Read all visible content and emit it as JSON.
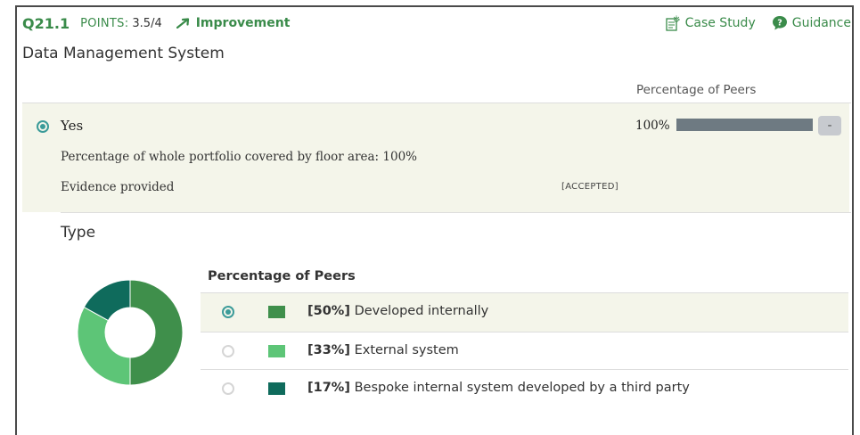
{
  "header": {
    "question_number": "Q21.1",
    "points_label": "POINTS:",
    "points_value": "3.5/4",
    "status": "Improvement",
    "case_study_label": "Case Study",
    "guidance_label": "Guidance"
  },
  "section_title": "Data Management System",
  "peers_header": "Percentage of Peers",
  "answer": {
    "label": "Yes",
    "selected": true,
    "peer_percentage_text": "100%",
    "peer_percentage": 100,
    "remove_button_label": "-",
    "coverage_text": "Percentage of whole portfolio covered by floor area: 100%",
    "evidence_text": "Evidence provided",
    "evidence_status": "[ACCEPTED]"
  },
  "type_section": {
    "title": "Type",
    "table_header": "Percentage of Peers",
    "options": [
      {
        "percent_label": "[50%]",
        "text": "Developed internally",
        "selected": true,
        "color": "#3f8f4b"
      },
      {
        "percent_label": "[33%]",
        "text": "External system",
        "selected": false,
        "color": "#5dc577"
      },
      {
        "percent_label": "[17%]",
        "text": "Bespoke internal system developed by a third party",
        "selected": false,
        "color": "#0f6b5c"
      }
    ]
  },
  "chart_data": {
    "type": "pie",
    "categories": [
      "Developed internally",
      "External system",
      "Bespoke internal system developed by a third party"
    ],
    "values": [
      50,
      33,
      17
    ],
    "colors": [
      "#3f8f4b",
      "#5dc577",
      "#0f6b5c"
    ],
    "donut": true
  },
  "colors": {
    "accent_green": "#3a8b4a",
    "radio_teal": "#3b9b99",
    "selected_row_bg": "#f4f5ea",
    "bar_fill": "#6e7a82"
  }
}
